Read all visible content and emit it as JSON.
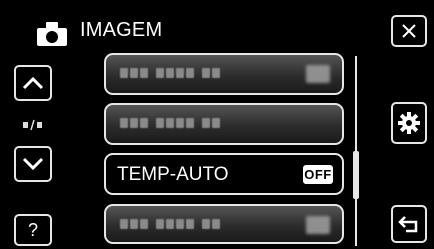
{
  "header": {
    "title": "IMAGEM",
    "icon": "camera-icon"
  },
  "nav": {
    "close_icon": "close-icon",
    "up_icon": "chevron-up-icon",
    "down_icon": "chevron-down-icon",
    "help_label": "?",
    "page_indicator": "▪/▪",
    "settings_icon": "gear-icon",
    "back_icon": "back-icon"
  },
  "menu": {
    "items": [
      {
        "label": "",
        "obscured": true
      },
      {
        "label": "",
        "obscured": true
      },
      {
        "label": "TEMP-AUTO",
        "value": "OFF",
        "selected": true
      },
      {
        "label": "",
        "obscured": true
      }
    ]
  },
  "colors": {
    "background": "#000000",
    "border": "#e6e6e6",
    "text": "#ffffff"
  }
}
